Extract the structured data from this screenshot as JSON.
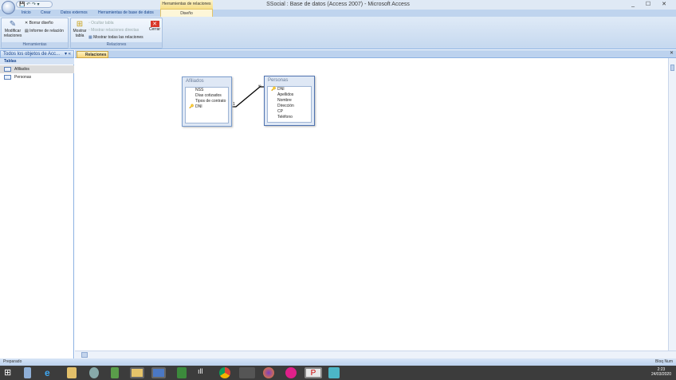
{
  "window": {
    "title": "SSocial : Base de datos (Access 2007) - Microsoft Access",
    "contextual_header": "Herramientas de relaciones",
    "controls": "_ ☐ ✕"
  },
  "ribbon": {
    "tabs": [
      "Inicio",
      "Crear",
      "Datos externos",
      "Herramientas de base de datos"
    ],
    "active_tab": "Diseño",
    "groups": {
      "herramientas": {
        "label": "Herramientas",
        "modificar": "Modificar relaciones",
        "borrar": "Borrar diseño",
        "informe": "Informe de relación"
      },
      "relaciones": {
        "label": "Relaciones",
        "mostrar_tabla": "Mostrar tabla",
        "ocultar": "Ocultar tabla",
        "directas": "Mostrar relaciones directas",
        "todas": "Mostrar todas las relaciones",
        "cerrar": "Cerrar"
      }
    }
  },
  "nav": {
    "header": "Todos los objetos de Acc...",
    "section": "Tablas",
    "items": [
      "Afiliados",
      "Personas"
    ]
  },
  "doc_tab": "Relaciones",
  "tables": [
    {
      "name": "Afiliados",
      "fields": [
        "NSS",
        "Días cotizados",
        "Tipos de contrato",
        "DNI"
      ],
      "key": "DNI"
    },
    {
      "name": "Personas",
      "fields": [
        "DNI",
        "Apellidos",
        "Nombre",
        "Dirección",
        "CP",
        "Teléfono"
      ],
      "key": "DNI"
    }
  ],
  "relationship": {
    "from": "Afiliados.DNI",
    "to": "Personas.DNI",
    "from_card": "1",
    "to_card": "∞"
  },
  "status": {
    "left": "Preparado",
    "right": "Bloq Num"
  },
  "clock": {
    "time": "2:23",
    "date": "24/03/2020"
  },
  "colors": {
    "ribbon": "#c5d8ef",
    "accent": "#15428b",
    "taskbar": "#3c3c3c"
  }
}
